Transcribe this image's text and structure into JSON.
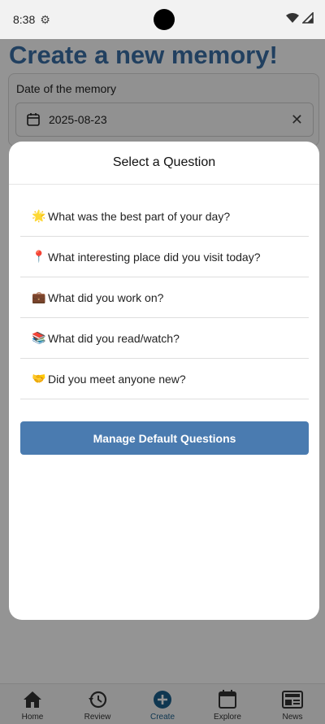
{
  "status_bar": {
    "time": "8:38"
  },
  "page": {
    "title": "Create a new memory!",
    "date_label": "Date of the memory",
    "date_value": "2025-08-23"
  },
  "modal": {
    "title": "Select a Question",
    "questions": [
      {
        "emoji": "🌟",
        "text": "What was the best part of your day?"
      },
      {
        "emoji": "📍",
        "text": "What interesting place did you visit today?"
      },
      {
        "emoji": "💼",
        "text": "What did you work on?"
      },
      {
        "emoji": "📚",
        "text": "What did you read/watch?"
      },
      {
        "emoji": "🤝",
        "text": "Did you meet anyone new?"
      }
    ],
    "manage_button": "Manage Default Questions"
  },
  "bottom_nav": {
    "items": [
      {
        "label": "Home",
        "icon": "home-icon"
      },
      {
        "label": "Review",
        "icon": "history-icon"
      },
      {
        "label": "Create",
        "icon": "add-circle-icon"
      },
      {
        "label": "Explore",
        "icon": "calendar-icon"
      },
      {
        "label": "News",
        "icon": "newspaper-icon"
      }
    ],
    "active": "Create"
  },
  "colors": {
    "accent": "#4a7bb0",
    "title": "#3a6ea5",
    "active_nav": "#1b5f8c"
  }
}
